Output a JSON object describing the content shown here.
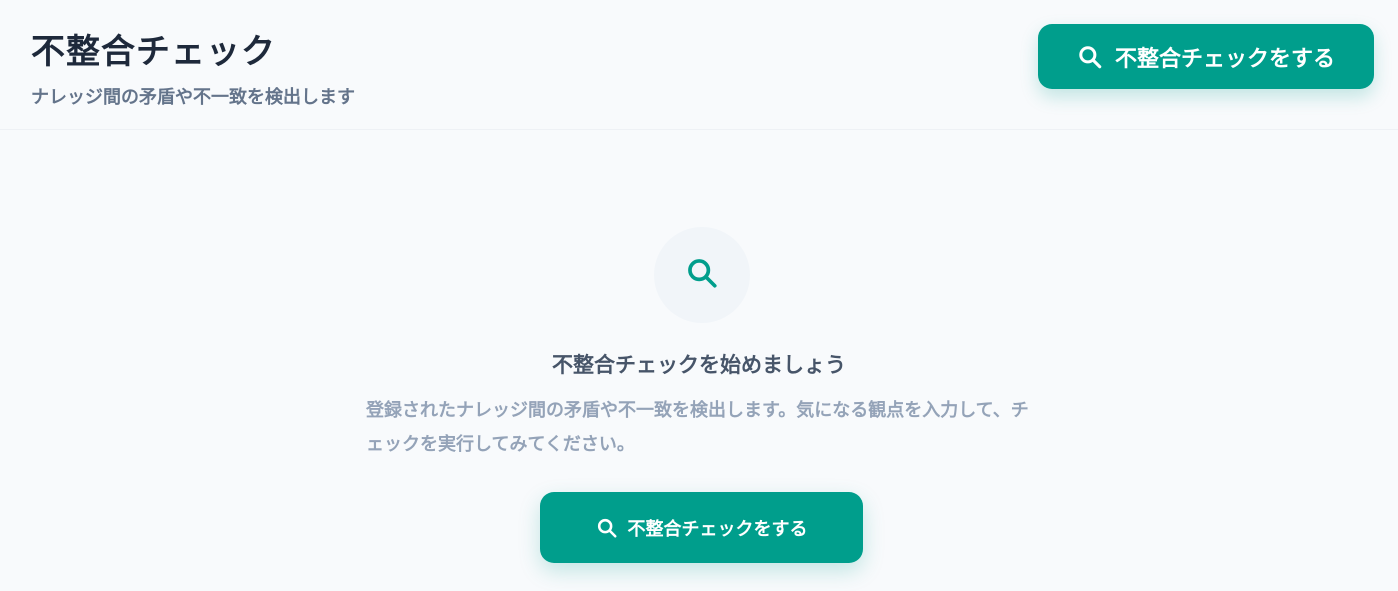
{
  "header": {
    "title": "不整合チェック",
    "subtitle": "ナレッジ間の矛盾や不一致を検出します",
    "action_label": "不整合チェックをする"
  },
  "empty_state": {
    "icon": "search-icon",
    "title": "不整合チェックを始めましょう",
    "description": "登録されたナレッジ間の矛盾や不一致を検出します。気になる観点を入力して、チェックを実行してみてください。",
    "action_label": "不整合チェックをする"
  },
  "colors": {
    "accent": "#009e8c",
    "background": "#f8fafc",
    "title": "#1e293b",
    "subtitle": "#64748b",
    "muted": "#94a3b8"
  }
}
